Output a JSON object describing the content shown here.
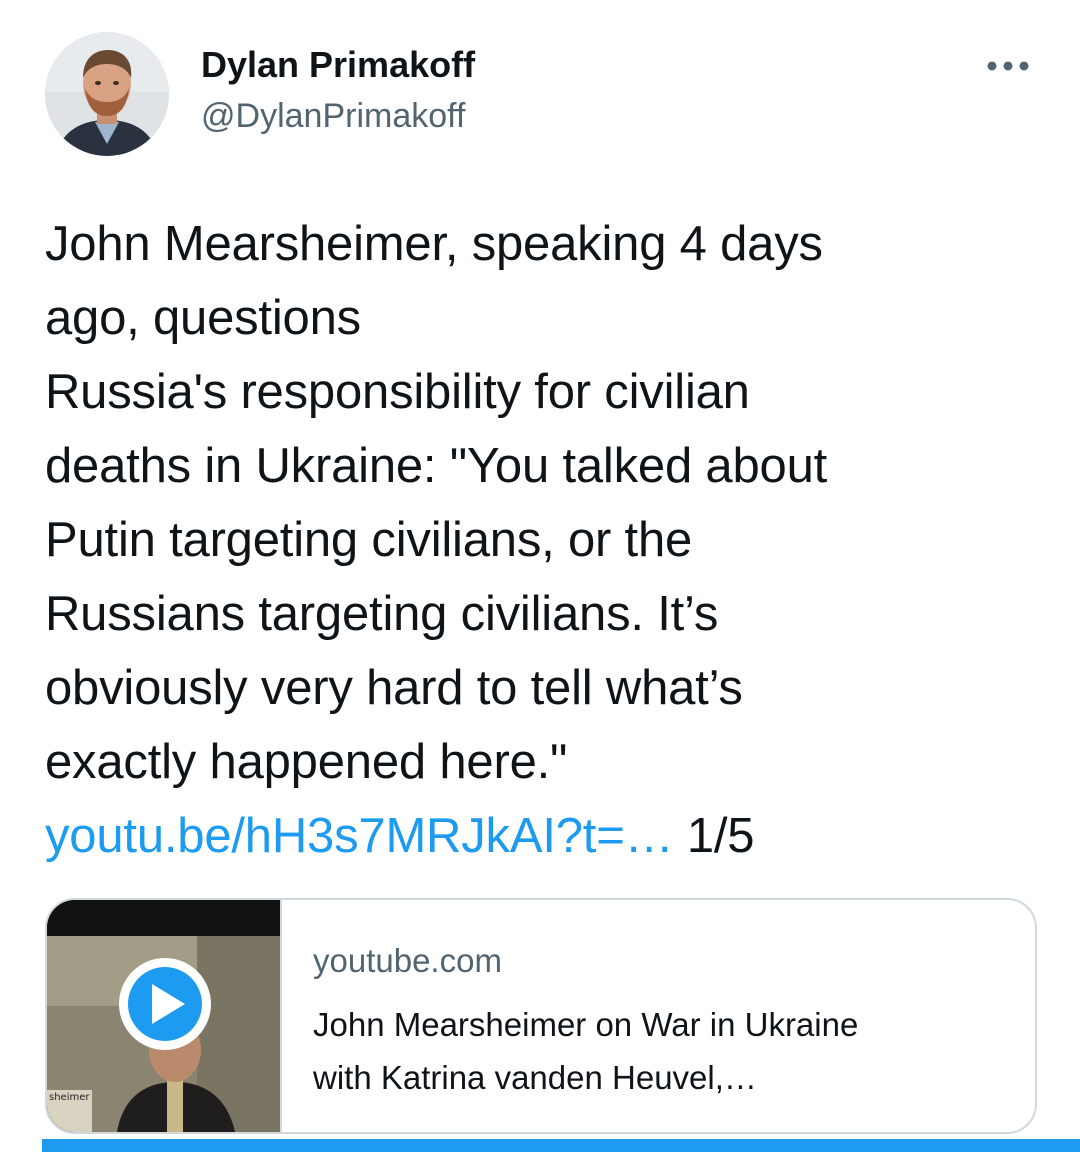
{
  "author": {
    "display_name": "Dylan Primakoff",
    "handle": "@DylanPrimakoff"
  },
  "tweet": {
    "text_lines": [
      "John Mearsheimer, speaking 4 days",
      "ago, questions",
      "Russia's responsibility for civilian",
      "deaths in Ukraine: \"You talked about",
      "Putin targeting civilians, or the",
      "Russians targeting civilians. It’s",
      "obviously very hard to tell what’s",
      "exactly happened here.\""
    ],
    "link_text": "youtu.be/hH3s7MRJkAI?t=…",
    "thread_counter": "1/5"
  },
  "link_card": {
    "domain": "youtube.com",
    "title_lines": [
      "John Mearsheimer on War in Ukraine",
      "with Katrina vanden Heuvel,…"
    ],
    "thumbnail_caption": "sheimer"
  },
  "colors": {
    "link": "#1d9bf0",
    "text": "#0f1419",
    "secondary": "#536471",
    "border": "#cfd9de"
  },
  "icons": {
    "more": "more-horizontal-icon",
    "play": "play-icon"
  }
}
